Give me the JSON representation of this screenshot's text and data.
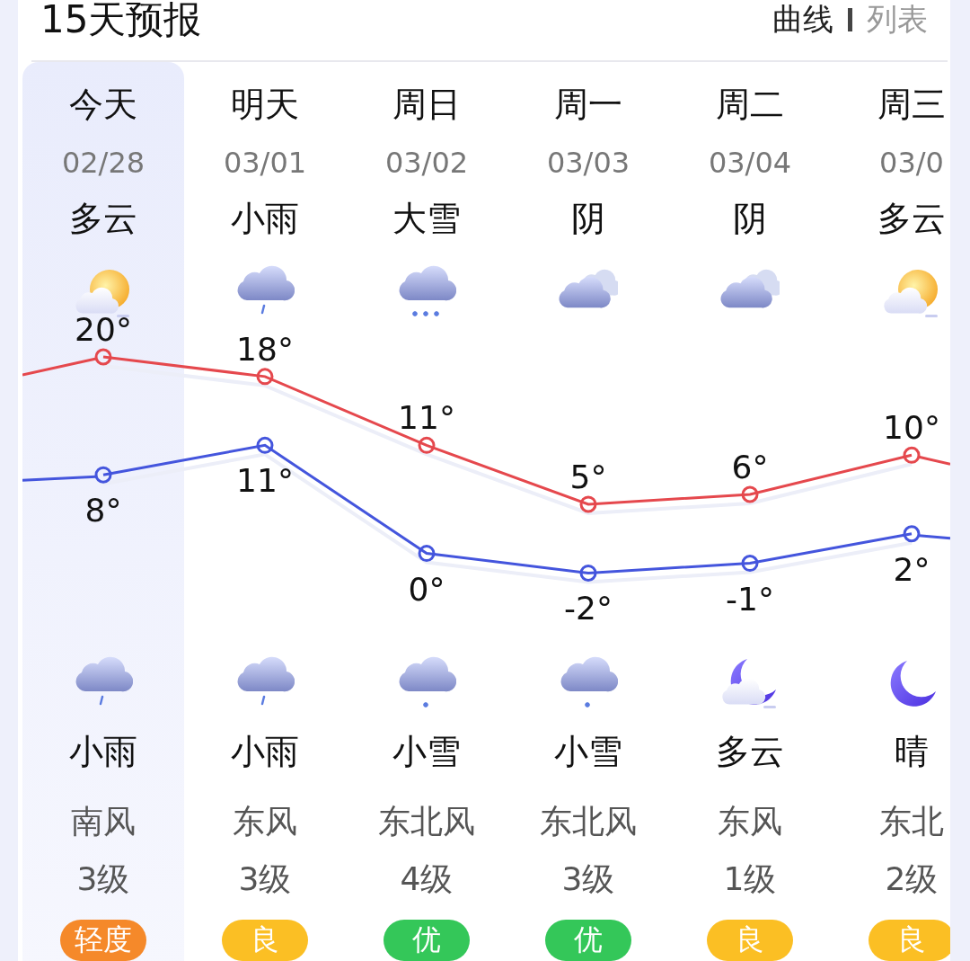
{
  "header": {
    "title": "15天预报",
    "views": [
      {
        "label": "曲线",
        "selected": true
      },
      {
        "label": "列表",
        "selected": false
      }
    ]
  },
  "days": [
    {
      "label": "今天",
      "date": "02/28",
      "selected": true,
      "day_weather": {
        "text": "多云",
        "kind": "partly-cloudy"
      },
      "night_weather": {
        "text": "小雨",
        "kind": "rain"
      },
      "wind": "南风",
      "wind_level": "3级",
      "aqi": {
        "text": "轻度",
        "color": "#f5892a"
      }
    },
    {
      "label": "明天",
      "date": "03/01",
      "selected": false,
      "day_weather": {
        "text": "小雨",
        "kind": "rain"
      },
      "night_weather": {
        "text": "小雨",
        "kind": "rain"
      },
      "wind": "东风",
      "wind_level": "3级",
      "aqi": {
        "text": "良",
        "color": "#fbbf24"
      }
    },
    {
      "label": "周日",
      "date": "03/02",
      "selected": false,
      "day_weather": {
        "text": "大雪",
        "kind": "heavy-snow"
      },
      "night_weather": {
        "text": "小雪",
        "kind": "light-snow"
      },
      "wind": "东北风",
      "wind_level": "4级",
      "aqi": {
        "text": "优",
        "color": "#34c759"
      }
    },
    {
      "label": "周一",
      "date": "03/03",
      "selected": false,
      "day_weather": {
        "text": "阴",
        "kind": "overcast"
      },
      "night_weather": {
        "text": "小雪",
        "kind": "light-snow"
      },
      "wind": "东北风",
      "wind_level": "3级",
      "aqi": {
        "text": "优",
        "color": "#34c759"
      }
    },
    {
      "label": "周二",
      "date": "03/04",
      "selected": false,
      "day_weather": {
        "text": "阴",
        "kind": "overcast"
      },
      "night_weather": {
        "text": "多云",
        "kind": "cloudy-night"
      },
      "wind": "东风",
      "wind_level": "1级",
      "aqi": {
        "text": "良",
        "color": "#fbbf24"
      }
    },
    {
      "label": "周三",
      "date": "03/0",
      "selected": false,
      "day_weather": {
        "text": "多云",
        "kind": "partly-cloudy"
      },
      "night_weather": {
        "text": "晴",
        "kind": "clear-night"
      },
      "wind": "东北",
      "wind_level": "2级",
      "aqi": {
        "text": "良",
        "color": "#fbbf24"
      }
    }
  ],
  "chart_data": {
    "type": "line",
    "categories": [
      null,
      null,
      null,
      null,
      null,
      null
    ],
    "series": [
      {
        "color": "#e5484d",
        "marker": "circle",
        "values": [
          20,
          18,
          11,
          5,
          6,
          10
        ],
        "value_labels": [
          "20°",
          "18°",
          "11°",
          "5°",
          "6°",
          "10°"
        ]
      },
      {
        "color": "#4455dd",
        "marker": "circle",
        "values": [
          8,
          11,
          0,
          -2,
          -1,
          2
        ],
        "value_labels": [
          "8°",
          "11°",
          "0°",
          "-2°",
          "-1°",
          "2°"
        ]
      }
    ]
  }
}
